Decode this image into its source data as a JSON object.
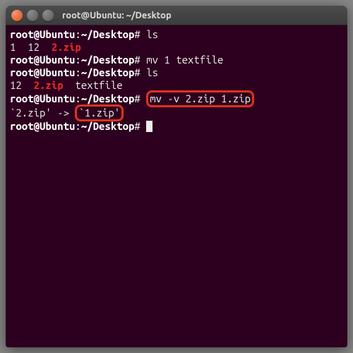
{
  "window": {
    "title": "root@Ubuntu: ~/Desktop"
  },
  "terminal": {
    "prompt_user": "root@Ubuntu",
    "prompt_colon": ":",
    "prompt_path": "~/Desktop",
    "prompt_hash": "#",
    "lines": {
      "l1_cmd": "ls",
      "l2_a": "1  12  ",
      "l2_zip": "2.zip",
      "l3_cmd": "mv 1 textfile",
      "l4_cmd": "ls",
      "l5_a": "12  ",
      "l5_zip": "2.zip",
      "l5_b": "  textfile",
      "l6_cmd": "mv -v 2.zip 1.zip",
      "l7_a": "`2.zip' -> ",
      "l7_box": "`1.zip'",
      "l8_cmd": ""
    }
  }
}
